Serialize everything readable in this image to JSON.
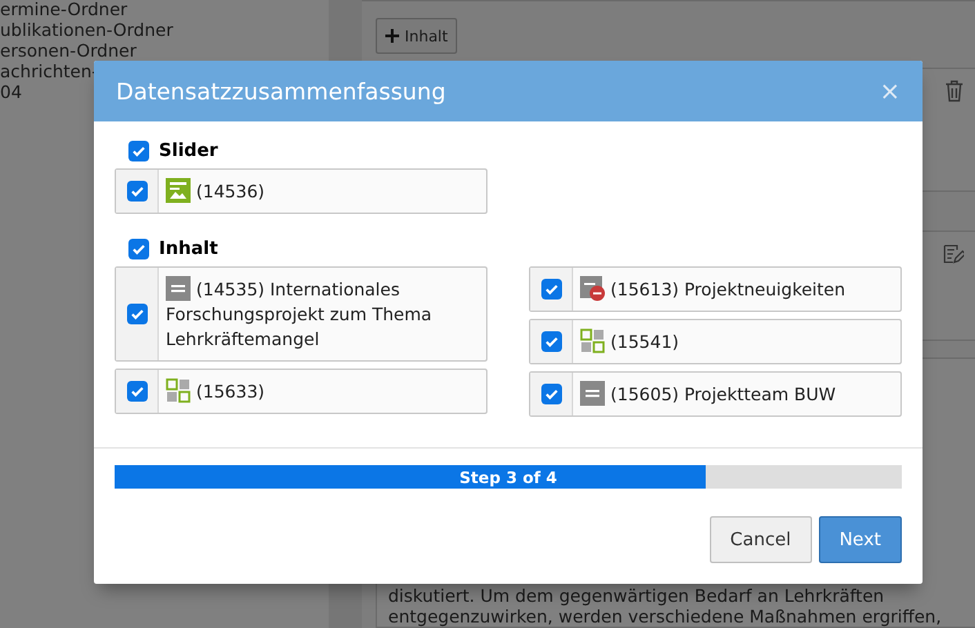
{
  "background": {
    "tree": [
      "ermine-Ordner",
      "ublikationen-Ordner",
      "ersonen-Ordner",
      "achrichten-",
      "04"
    ],
    "add_button": "Inhalt",
    "body_text": [
      "diskutiert. Um dem gegenwärtigen Bedarf an Lehrkräften",
      "entgegenzuwirken, werden verschiedene Maßnahmen ergriffen,"
    ]
  },
  "dialog": {
    "title": "Datensatzzusammenfassung",
    "close": "×",
    "groups": [
      {
        "title": "Slider",
        "checked": true,
        "columns": [
          [
            {
              "label": "(14536)",
              "kind": "image",
              "checked": true
            }
          ],
          []
        ]
      },
      {
        "title": "Inhalt",
        "checked": true,
        "columns": [
          [
            {
              "label": "(14535) Internationales Forschungsprojekt zum Thema Lehrkräftemangel",
              "kind": "text",
              "checked": true
            },
            {
              "label": "(15633)",
              "kind": "grid",
              "checked": true
            }
          ],
          [
            {
              "label": "(15613) Projektneuigkeiten",
              "kind": "text-hidden",
              "checked": true
            },
            {
              "label": "(15541)",
              "kind": "grid",
              "checked": true
            },
            {
              "label": "(15605) Projektteam BUW",
              "kind": "text",
              "checked": true
            }
          ]
        ]
      }
    ],
    "progress": {
      "label": "Step 3 of 4",
      "level": 0.75
    },
    "buttons": [
      {
        "label": "Cancel",
        "kind": "default"
      },
      {
        "label": "Next",
        "kind": "primary"
      }
    ]
  }
}
